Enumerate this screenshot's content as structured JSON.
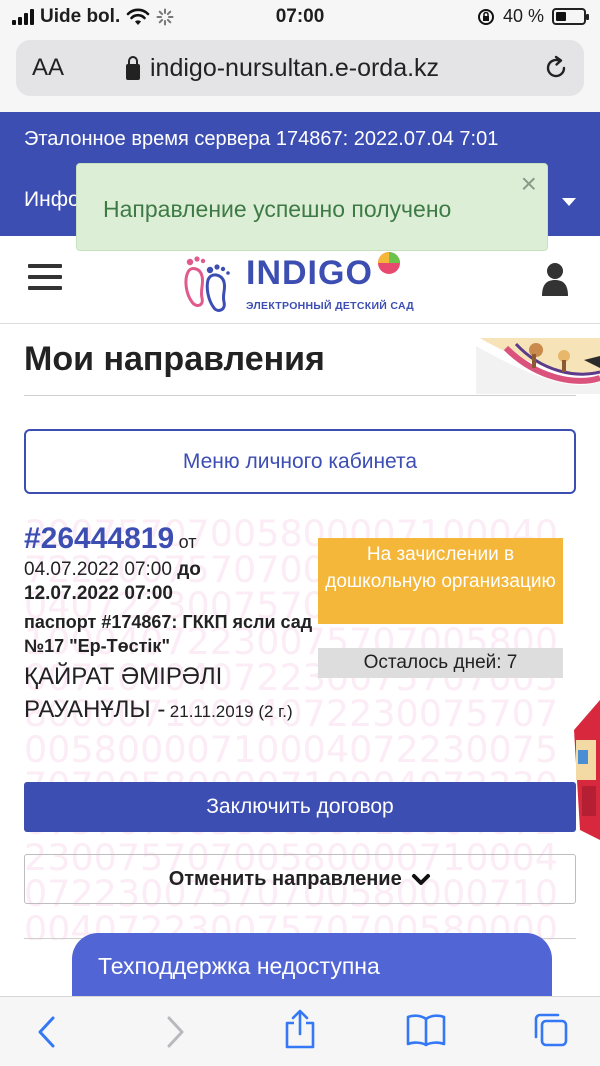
{
  "status_bar": {
    "carrier": "Uide bol.",
    "time": "07:00",
    "battery_percent": "40 %",
    "battery_level": 0.4
  },
  "browser": {
    "text_size_label": "AA",
    "url": "indigo-nursultan.e-orda.kz"
  },
  "site_header": {
    "server_time": "Эталонное время сервера 174867: 2022.07.04 7:01",
    "info_text": "Инфо"
  },
  "toast": {
    "message": "Направление успешно получено",
    "close_label": "×"
  },
  "logo": {
    "title": "INDIGO",
    "subtitle": "ЭЛЕКТРОННЫЙ ДЕТСКИЙ САД"
  },
  "page": {
    "title": "Мои направления",
    "menu_button": "Меню личного кабинета"
  },
  "request": {
    "number": "#26444819",
    "from_word": "от",
    "date_from": "04.07.2022 07:00",
    "to_word": "до",
    "date_to": "12.07.2022 07:00",
    "kindergarten": "паспорт #174867: ГККП ясли сад №17 \"Ер-Төстік\"",
    "child_name": "ҚАЙРАТ ӘМІРӘЛІ РАУАНҰЛЫ -",
    "child_dob": "21.11.2019 (2 г.)",
    "status": "На зачислении в дошкольную организацию",
    "days_left": "Осталось дней: 7",
    "contract_button": "Заключить договор",
    "cancel_button": "Отменить направление",
    "watermark": "3007570700580000710004072230075707005800007100040722300757070058000071000407223007570700580000710004072230075707005800007100040722300757070058000071000407223007570700580000710004072230075707005800007100040722300757070058000071000407223007570700580000710004072230075707005800007100040722300757070058"
  },
  "support": {
    "label": "Техподдержка недоступна"
  },
  "colors": {
    "brand": "#3d4eb3",
    "status_orange": "#f4b73a",
    "toast_bg": "#dcefd6",
    "toast_text": "#3e7a45",
    "support_bg": "#5166d4"
  }
}
